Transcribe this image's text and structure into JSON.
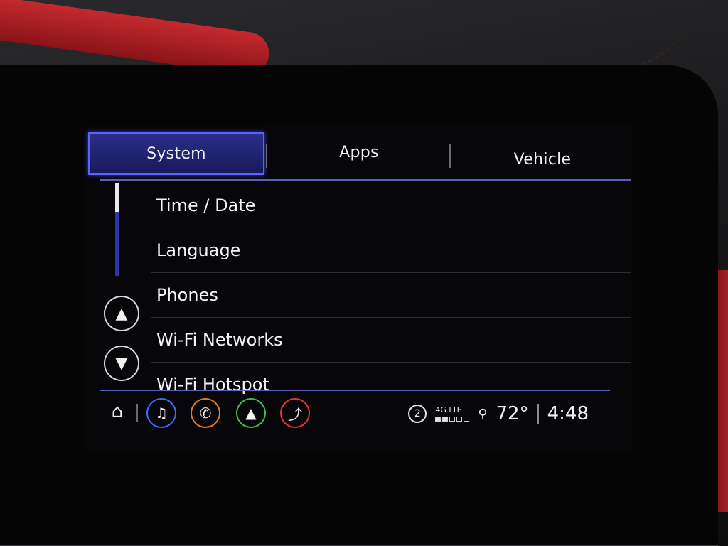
{
  "tabs": [
    {
      "label": "System",
      "active": true
    },
    {
      "label": "Apps",
      "active": false
    },
    {
      "label": "Vehicle",
      "active": false
    }
  ],
  "menu": {
    "items": [
      {
        "label": "Time / Date"
      },
      {
        "label": "Language"
      },
      {
        "label": "Phones"
      },
      {
        "label": "Wi-Fi Networks"
      },
      {
        "label": "Wi-Fi Hotspot"
      }
    ],
    "scroll_up_icon": "up-triangle-icon",
    "scroll_down_icon": "down-triangle-icon"
  },
  "bottom_bar": {
    "apps": [
      {
        "name": "music-icon",
        "color": "#3a6cff"
      },
      {
        "name": "phone-icon",
        "color": "#e57a20"
      },
      {
        "name": "navigation-icon",
        "color": "#34c04a"
      },
      {
        "name": "climate-icon",
        "color": "#e0353a"
      }
    ],
    "status": {
      "notification_count": "2",
      "network": "4G LTE",
      "signal_bars_on": 2,
      "signal_bars_total": 5,
      "temperature": "72°",
      "time": "4:48"
    }
  },
  "colors": {
    "accent": "#5a63ff",
    "divider": "#5a5fb8"
  }
}
